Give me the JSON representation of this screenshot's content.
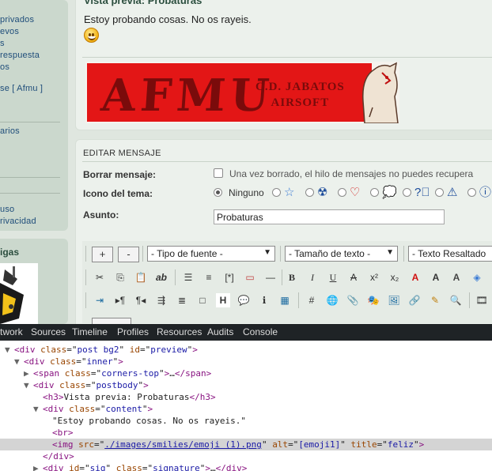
{
  "sidebar": {
    "links": [
      "privados",
      "evos",
      "s",
      "respuesta",
      "os",
      "se [ Afmu ]",
      "arios",
      "",
      "uso",
      "rivacidad"
    ],
    "section_title": "igas"
  },
  "preview": {
    "title": "Vista previa: Probaturas",
    "text": "Estoy probando cosas. No os rayeis.",
    "banner": {
      "main": "AFMU",
      "club_line1": "C.D. JABATOS",
      "club_line2": "AIRSOFT"
    }
  },
  "editor": {
    "section_title": "EDITAR MENSAJE",
    "delete_label": "Borrar mensaje:",
    "delete_text": "Una vez borrado, el hilo de mensajes no puedes recupera",
    "icon_label": "Icono del tema:",
    "icon_none": "Ninguno",
    "subject_label": "Asunto:",
    "subject_value": "Probaturas",
    "toolbar": {
      "plus": "+",
      "minus": "-",
      "font_type": "- Tipo de fuente -",
      "font_size": "- Tamaño de texto -",
      "highlight": "- Texto Resaltado"
    }
  },
  "devtools": {
    "tabs": [
      "twork",
      "Sources",
      "Timeline",
      "Profiles",
      "Resources",
      "Audits",
      "Console"
    ],
    "lines": [
      {
        "indent": 0,
        "tri": "▼",
        "tag": "div",
        "attrs": [
          [
            "class",
            "post bg2"
          ],
          [
            "id",
            "preview"
          ]
        ],
        "close": false
      },
      {
        "indent": 1,
        "tri": "▼",
        "tag": "div",
        "attrs": [
          [
            "class",
            "inner"
          ]
        ],
        "close": false
      },
      {
        "indent": 2,
        "tri": "▶",
        "tag": "span",
        "attrs": [
          [
            "class",
            "corners-top"
          ]
        ],
        "close": true,
        "inner": "…",
        "closeTag": "span"
      },
      {
        "indent": 2,
        "tri": "▼",
        "tag": "div",
        "attrs": [
          [
            "class",
            "postbody"
          ]
        ],
        "close": false
      },
      {
        "indent": 3,
        "tri": "",
        "tag": "h3",
        "attrs": [],
        "close": true,
        "inner": "Vista previa: Probaturas",
        "closeTag": "h3"
      },
      {
        "indent": 3,
        "tri": "▼",
        "tag": "div",
        "attrs": [
          [
            "class",
            "content"
          ]
        ],
        "close": false
      },
      {
        "indent": 4,
        "tri": "",
        "text": "\"Estoy probando cosas. No os rayeis.\""
      },
      {
        "indent": 4,
        "tri": "",
        "tag": "br",
        "attrs": [],
        "close": false
      },
      {
        "indent": 4,
        "tri": "",
        "tag": "img",
        "attrs": [
          [
            "src",
            "./images/smilies/emoji (1).png"
          ],
          [
            "alt",
            "[emoji1]"
          ],
          [
            "title",
            "feliz"
          ]
        ],
        "close": false,
        "selected": true
      },
      {
        "indent": 3,
        "tri": "",
        "endTag": "div"
      },
      {
        "indent": 3,
        "tri": "▶",
        "tag": "div",
        "attrs": [
          [
            "id",
            "sig"
          ],
          [
            "class",
            "signature"
          ]
        ],
        "close": true,
        "inner": "…",
        "closeTag": "div"
      }
    ]
  }
}
